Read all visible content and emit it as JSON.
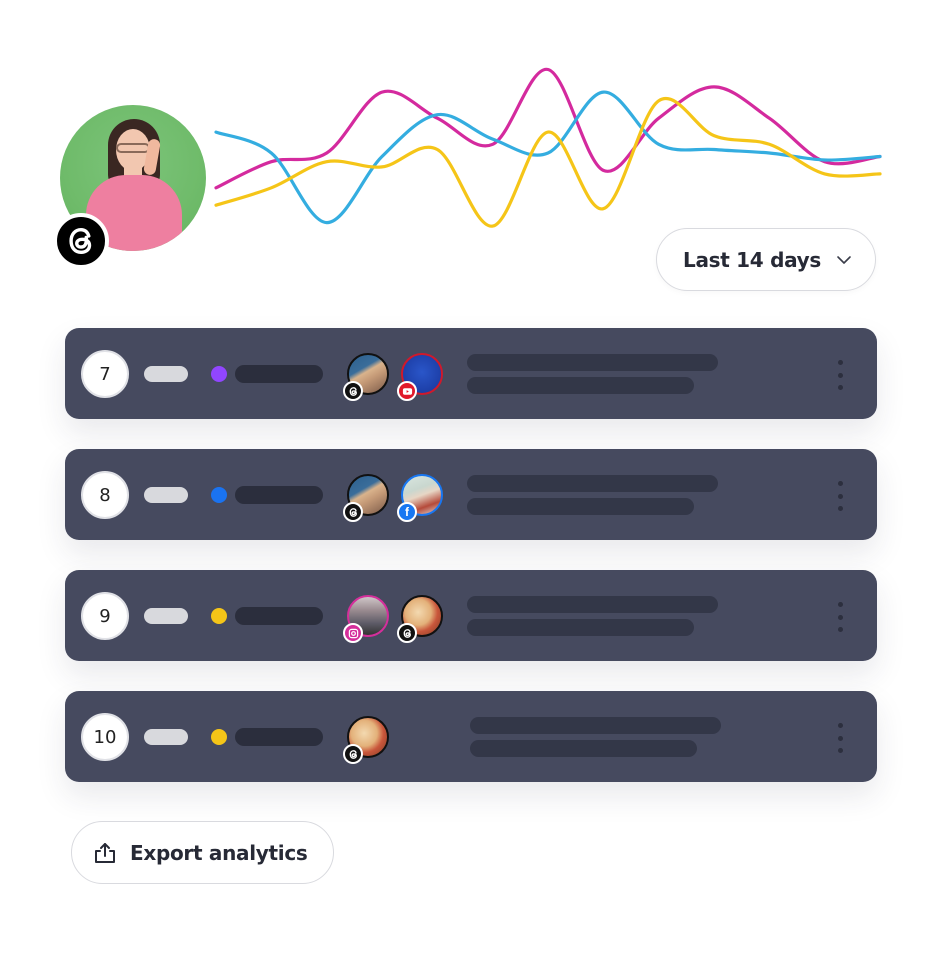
{
  "header": {
    "profile": {
      "avatar_alt": "Woman in pink blazer adjusting glasses",
      "network_icon": "threads-icon"
    },
    "date_range": {
      "selected": "Last 14 days",
      "icon": "chevron-down-icon"
    }
  },
  "colors": {
    "magenta": "#d42a9e",
    "blue": "#34ade0",
    "yellow": "#f5c518",
    "row_bg": "#464a5f",
    "purple_dot": "#9146ff",
    "blue_dot": "#1a73f0",
    "yellow_dot": "#f5c518"
  },
  "chart_data": {
    "type": "line",
    "title": "",
    "xlabel": "",
    "ylabel": "",
    "grid": false,
    "legend": "none",
    "note": "Decorative smoothed engagement curves without axes; values are relative (0-100).",
    "x": [
      0,
      1,
      2,
      3,
      4,
      5,
      6,
      7,
      8,
      9,
      10,
      11,
      12
    ],
    "series": [
      {
        "name": "magenta",
        "color": "#d42a9e",
        "values": [
          30,
          45,
          50,
          85,
          70,
          55,
          98,
          40,
          70,
          88,
          70,
          45,
          48
        ]
      },
      {
        "name": "blue",
        "color": "#34ade0",
        "values": [
          62,
          50,
          10,
          48,
          72,
          58,
          50,
          85,
          55,
          52,
          50,
          46,
          48
        ]
      },
      {
        "name": "yellow",
        "color": "#f5c518",
        "values": [
          20,
          30,
          45,
          42,
          52,
          8,
          62,
          18,
          80,
          60,
          55,
          38,
          38
        ]
      }
    ]
  },
  "rows": [
    {
      "rank": "7",
      "dot_color": "#9146ff",
      "avatars": [
        {
          "kind": "street",
          "network": "threads"
        },
        {
          "kind": "blue",
          "network": "youtube"
        }
      ]
    },
    {
      "rank": "8",
      "dot_color": "#1a73f0",
      "avatars": [
        {
          "kind": "street",
          "network": "threads"
        },
        {
          "kind": "drink",
          "network": "facebook"
        }
      ]
    },
    {
      "rank": "9",
      "dot_color": "#f5c518",
      "avatars": [
        {
          "kind": "person",
          "network": "instagram"
        },
        {
          "kind": "food",
          "network": "threads"
        }
      ]
    },
    {
      "rank": "10",
      "dot_color": "#f5c518",
      "avatars": [
        {
          "kind": "food",
          "network": "threads"
        }
      ]
    }
  ],
  "footer": {
    "export_label": "Export analytics",
    "export_icon": "upload-icon"
  }
}
